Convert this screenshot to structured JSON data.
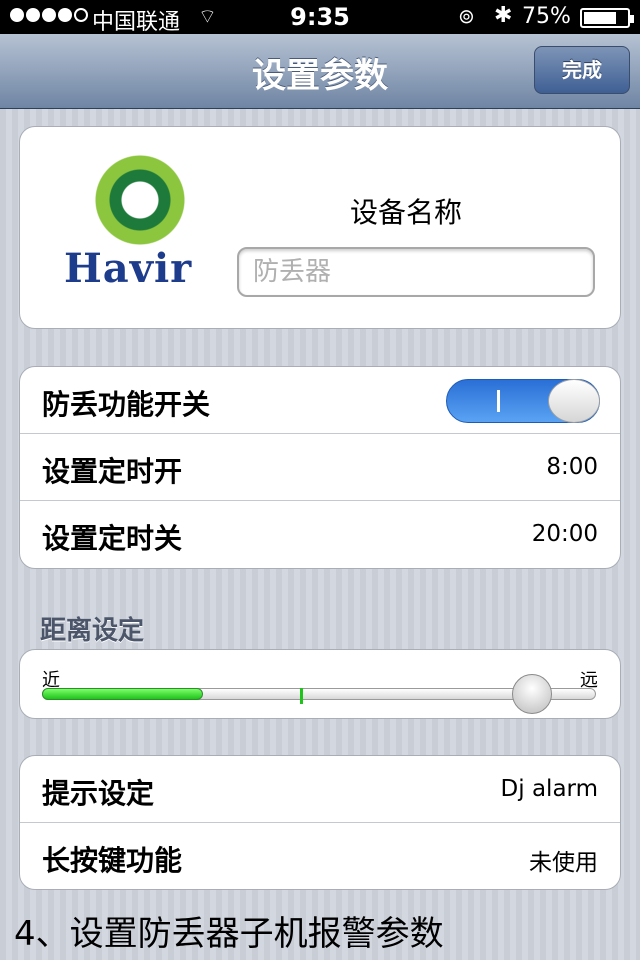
{
  "status_bar": {
    "carrier": "中国联通",
    "time": "9:35",
    "battery_percent": "75%",
    "battery_level": 0.75,
    "signal_bars": 4,
    "icons": [
      "signal-dots-icon",
      "wifi-icon",
      "rotation-lock-icon",
      "bluetooth-icon",
      "battery-icon"
    ]
  },
  "navbar": {
    "title": "设置参数",
    "done_label": "完成"
  },
  "device": {
    "logo_text": "Havir",
    "name_label": "设备名称",
    "name_placeholder": "防丢器"
  },
  "settings": {
    "anti_loss_label": "防丢功能开关",
    "anti_loss_on": true,
    "timer_on_label": "设置定时开",
    "timer_on_value": "8:00",
    "timer_off_label": "设置定时关",
    "timer_off_value": "20:00"
  },
  "distance": {
    "section_title": "距离设定",
    "near_label": "近",
    "far_label": "远",
    "fill_level": 0.29,
    "marker_level": 0.465,
    "knob_level": 0.885
  },
  "alerts": {
    "prompt_label": "提示设定",
    "prompt_value": "Dj alarm",
    "long_press_label": "长按键功能",
    "long_press_value": "未使用"
  },
  "caption": "4、设置防丢器子机报警参数",
  "colors": {
    "nav_gradient_top": "#b6c2d3",
    "nav_gradient_bottom": "#6f85a4",
    "toggle_on": "#2a6fd6",
    "slider_fill": "#1ec41a",
    "logo_blue": "#1e3c8c",
    "logo_green": "#8cc63f"
  }
}
